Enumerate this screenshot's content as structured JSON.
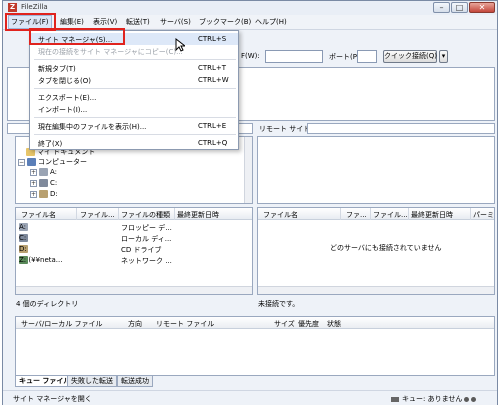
{
  "window": {
    "title": "FileZilla"
  },
  "menubar": [
    {
      "label": "ファイル(F)"
    },
    {
      "label": "編集(E)"
    },
    {
      "label": "表示(V)"
    },
    {
      "label": "転送(T)"
    },
    {
      "label": "サーバ(S)"
    },
    {
      "label": "ブックマーク(B)"
    },
    {
      "label": "ヘルプ(H)"
    }
  ],
  "file_menu": [
    {
      "label": "サイト マネージャ(S)...",
      "shortcut": "CTRL+S"
    },
    {
      "label": "現在の接続をサイト マネージャにコピー(C)...",
      "shortcut": ""
    },
    {
      "label": "新規タブ(T)",
      "shortcut": "CTRL+T"
    },
    {
      "label": "タブを閉じる(O)",
      "shortcut": "CTRL+W"
    },
    {
      "label": "エクスポート(E)...",
      "shortcut": ""
    },
    {
      "label": "インポート(I)...",
      "shortcut": ""
    },
    {
      "label": "現在編集中のファイルを表示(H)...",
      "shortcut": "CTRL+E"
    },
    {
      "label": "終了(X)",
      "shortcut": "CTRL+Q"
    }
  ],
  "quickconnect": {
    "host_label": "F(W):",
    "port_label": "ポート(P):",
    "button_label": "クイック接続(Q)"
  },
  "remote_site": {
    "label": "リモート サイト:"
  },
  "local_tree": [
    {
      "label": "マイ ドキュメント"
    },
    {
      "label": "コンピューター"
    },
    {
      "label": "A:"
    },
    {
      "label": "C:"
    },
    {
      "label": "D:"
    }
  ],
  "local_files": {
    "columns": [
      "ファイル名",
      "ファイル...",
      "ファイルの種類",
      "最終更新日時"
    ],
    "rows": [
      {
        "name": "A:",
        "type": "フロッピー デ..."
      },
      {
        "name": "C:",
        "type": "ローカル ディ..."
      },
      {
        "name": "D:",
        "type": "CD ドライブ"
      },
      {
        "name": "Z: (¥¥neta...",
        "type": "ネットワーク ..."
      }
    ],
    "status": "4 個のディレクトリ"
  },
  "remote_files": {
    "columns": [
      "ファイル名",
      "ファ...",
      "ファイル...",
      "最終更新日時",
      "パーミ"
    ],
    "empty_message": "どのサーバにも接続されていません",
    "status": "未接続です。"
  },
  "queue": {
    "columns": [
      "サーバ/ローカル ファイル",
      "方向",
      "リモート ファイル",
      "サイズ",
      "優先度",
      "状態"
    ],
    "tabs": [
      "キュー ファイル",
      "失敗した転送",
      "転送成功"
    ]
  },
  "statusbar": {
    "left": "サイト マネージャを開く",
    "queue": "キュー: ありません"
  },
  "colors": {
    "highlight_box": "#e0231e",
    "menu_hover": "#dde8f8"
  }
}
